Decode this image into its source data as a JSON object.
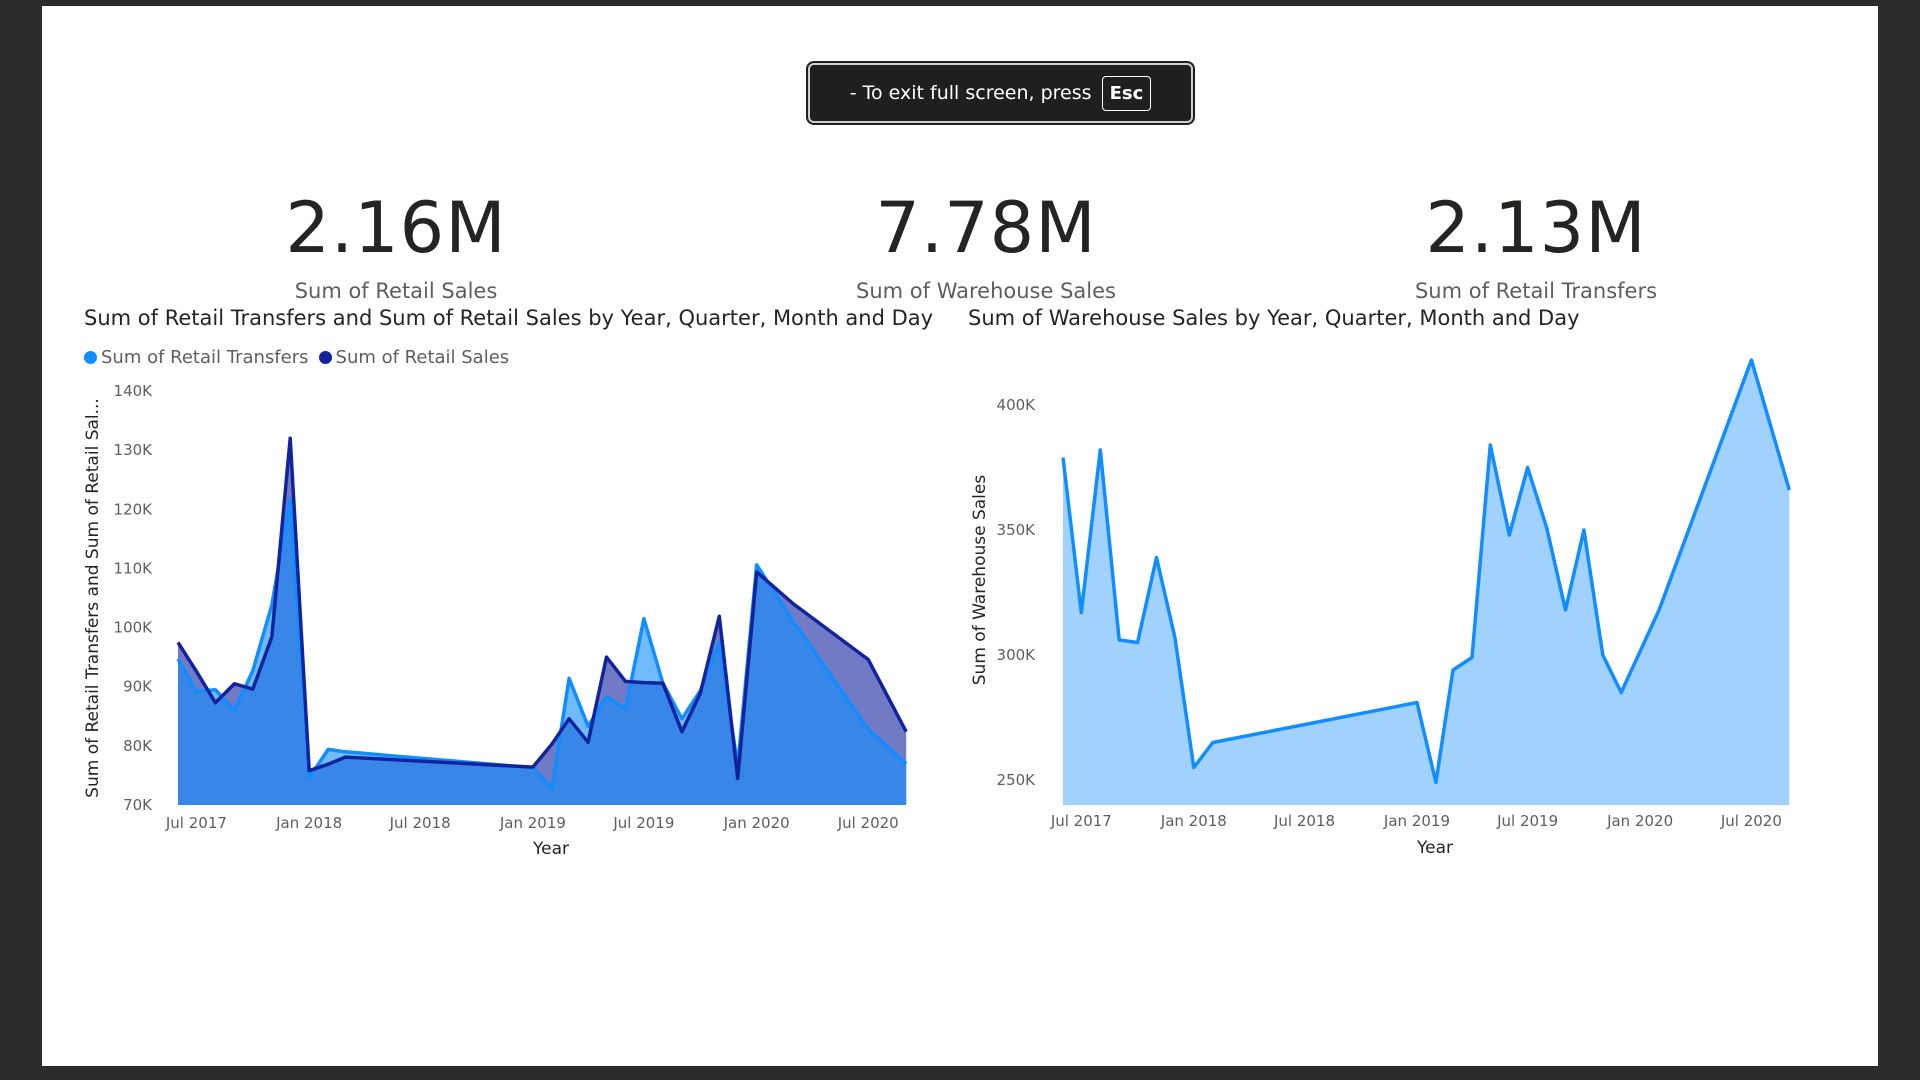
{
  "toast": {
    "prefix": "-  To exit full screen, press",
    "key": "Esc"
  },
  "kpis": [
    {
      "value": "2.16M",
      "label": "Sum of Retail Sales"
    },
    {
      "value": "7.78M",
      "label": "Sum of Warehouse Sales"
    },
    {
      "value": "2.13M",
      "label": "Sum of Retail Transfers"
    }
  ],
  "chart_data": [
    {
      "type": "area",
      "title": "Sum of Retail Transfers and Sum of Retail Sales by Year, Quarter, Month and Day",
      "xlabel": "Year",
      "ylabel": "Sum of Retail Transfers and Sum of Retail Sal...",
      "legend_position": "top-left",
      "xlim": [
        "2017-06-01",
        "2020-09-30"
      ],
      "ylim": [
        70000,
        140000
      ],
      "x_ticks": [
        {
          "date": "2017-07-01",
          "label": "Jul 2017"
        },
        {
          "date": "2018-01-01",
          "label": "Jan 2018"
        },
        {
          "date": "2018-07-01",
          "label": "Jul 2018"
        },
        {
          "date": "2019-01-01",
          "label": "Jan 2019"
        },
        {
          "date": "2019-07-01",
          "label": "Jul 2019"
        },
        {
          "date": "2020-01-01",
          "label": "Jan 2020"
        },
        {
          "date": "2020-07-01",
          "label": "Jul 2020"
        }
      ],
      "y_ticks": [
        {
          "v": 70000,
          "label": "70K"
        },
        {
          "v": 80000,
          "label": "80K"
        },
        {
          "v": 90000,
          "label": "90K"
        },
        {
          "v": 100000,
          "label": "100K"
        },
        {
          "v": 110000,
          "label": "110K"
        },
        {
          "v": 120000,
          "label": "120K"
        },
        {
          "v": 130000,
          "label": "130K"
        },
        {
          "v": 140000,
          "label": "140K"
        }
      ],
      "x": [
        "2017-06-01",
        "2017-07-01",
        "2017-08-01",
        "2017-09-01",
        "2017-10-01",
        "2017-11-01",
        "2017-12-01",
        "2018-01-01",
        "2018-02-01",
        "2018-03-01",
        "2019-01-01",
        "2019-02-01",
        "2019-03-01",
        "2019-04-01",
        "2019-05-01",
        "2019-06-01",
        "2019-07-01",
        "2019-08-01",
        "2019-09-01",
        "2019-10-01",
        "2019-11-01",
        "2019-12-01",
        "2020-01-01",
        "2020-03-01",
        "2020-07-01",
        "2020-09-01"
      ],
      "series": [
        {
          "name": "Sum of Retail Transfers",
          "color": "#118DFF",
          "values": [
            94700,
            89200,
            89500,
            86000,
            92700,
            103800,
            121700,
            74600,
            79400,
            79000,
            76300,
            72800,
            91400,
            83300,
            88300,
            86200,
            101500,
            90600,
            84600,
            89300,
            97500,
            76600,
            110600,
            101000,
            82800,
            77000
          ]
        },
        {
          "name": "Sum of Retail Sales",
          "color": "#12239E",
          "values": [
            97500,
            92600,
            87300,
            90500,
            89600,
            98400,
            132000,
            75800,
            76900,
            78100,
            76400,
            80300,
            84600,
            80600,
            95000,
            90900,
            90700,
            90600,
            82400,
            88900,
            101900,
            74500,
            109400,
            104000,
            94600,
            82400
          ]
        }
      ]
    },
    {
      "type": "area",
      "title": "Sum of Warehouse Sales by Year, Quarter, Month and Day",
      "xlabel": "Year",
      "ylabel": "Sum of Warehouse Sales",
      "xlim": [
        "2017-06-01",
        "2020-09-30"
      ],
      "ylim": [
        240000,
        420000
      ],
      "x_ticks": [
        {
          "date": "2017-07-01",
          "label": "Jul 2017"
        },
        {
          "date": "2018-01-01",
          "label": "Jan 2018"
        },
        {
          "date": "2018-07-01",
          "label": "Jul 2018"
        },
        {
          "date": "2019-01-01",
          "label": "Jan 2019"
        },
        {
          "date": "2019-07-01",
          "label": "Jul 2019"
        },
        {
          "date": "2020-01-01",
          "label": "Jan 2020"
        },
        {
          "date": "2020-07-01",
          "label": "Jul 2020"
        }
      ],
      "y_ticks": [
        {
          "v": 250000,
          "label": "250K"
        },
        {
          "v": 300000,
          "label": "300K"
        },
        {
          "v": 350000,
          "label": "350K"
        },
        {
          "v": 400000,
          "label": "400K"
        }
      ],
      "x": [
        "2017-06-01",
        "2017-07-01",
        "2017-08-01",
        "2017-09-01",
        "2017-10-01",
        "2017-11-01",
        "2017-12-01",
        "2018-01-01",
        "2018-02-01",
        "2019-01-01",
        "2019-02-01",
        "2019-03-01",
        "2019-04-01",
        "2019-05-01",
        "2019-06-01",
        "2019-07-01",
        "2019-08-01",
        "2019-09-01",
        "2019-10-01",
        "2019-11-01",
        "2019-12-01",
        "2020-02-01",
        "2020-07-01",
        "2020-09-01"
      ],
      "series": [
        {
          "name": "Sum of Warehouse Sales",
          "color": "#118DFF",
          "fill": "#A0D1FF",
          "values": [
            379000,
            317000,
            382000,
            306000,
            305000,
            339000,
            307000,
            255000,
            265000,
            281000,
            249000,
            294000,
            299000,
            384000,
            348000,
            375000,
            351000,
            318000,
            350000,
            300000,
            285000,
            318000,
            418000,
            366000
          ]
        }
      ]
    }
  ]
}
